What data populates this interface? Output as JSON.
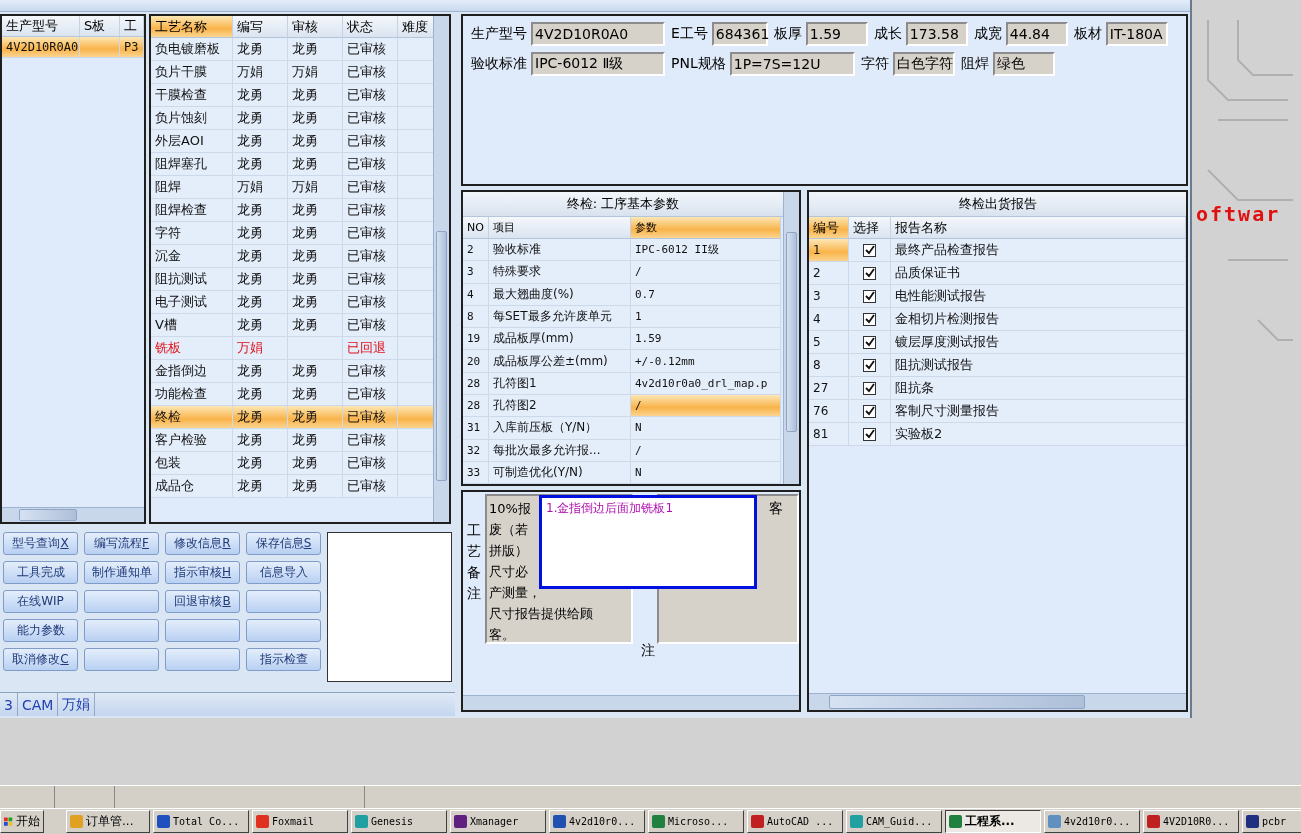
{
  "model_list": {
    "columns": [
      "生产型号",
      "S板",
      "工"
    ],
    "rows": [
      {
        "model": "4V2D10R0A0",
        "column_3": "P3",
        "selected": true
      }
    ]
  },
  "process_grid": {
    "columns": [
      {
        "label": "工艺名称",
        "highlighted": true
      },
      {
        "label": "编写",
        "highlighted": false
      },
      {
        "label": "审核",
        "highlighted": false
      },
      {
        "label": "状态",
        "highlighted": false
      },
      {
        "label": "难度",
        "highlighted": false
      }
    ],
    "rows": [
      {
        "name": "负电镀磨板",
        "writer": "龙勇",
        "reviewer": "龙勇",
        "status": "已审核",
        "returned": false,
        "selected": false
      },
      {
        "name": "负片干膜",
        "writer": "万娟",
        "reviewer": "万娟",
        "status": "已审核",
        "returned": false,
        "selected": false
      },
      {
        "name": "干膜检查",
        "writer": "龙勇",
        "reviewer": "龙勇",
        "status": "已审核",
        "returned": false,
        "selected": false
      },
      {
        "name": "负片蚀刻",
        "writer": "龙勇",
        "reviewer": "龙勇",
        "status": "已审核",
        "returned": false,
        "selected": false
      },
      {
        "name": "外层AOI",
        "writer": "龙勇",
        "reviewer": "龙勇",
        "status": "已审核",
        "returned": false,
        "selected": false
      },
      {
        "name": "阻焊塞孔",
        "writer": "龙勇",
        "reviewer": "龙勇",
        "status": "已审核",
        "returned": false,
        "selected": false
      },
      {
        "name": "阻焊",
        "writer": "万娟",
        "reviewer": "万娟",
        "status": "已审核",
        "returned": false,
        "selected": false
      },
      {
        "name": "阻焊检查",
        "writer": "龙勇",
        "reviewer": "龙勇",
        "status": "已审核",
        "returned": false,
        "selected": false
      },
      {
        "name": "字符",
        "writer": "龙勇",
        "reviewer": "龙勇",
        "status": "已审核",
        "returned": false,
        "selected": false
      },
      {
        "name": "沉金",
        "writer": "龙勇",
        "reviewer": "龙勇",
        "status": "已审核",
        "returned": false,
        "selected": false
      },
      {
        "name": "阻抗测试",
        "writer": "龙勇",
        "reviewer": "龙勇",
        "status": "已审核",
        "returned": false,
        "selected": false
      },
      {
        "name": "电子测试",
        "writer": "龙勇",
        "reviewer": "龙勇",
        "status": "已审核",
        "returned": false,
        "selected": false
      },
      {
        "name": "V槽",
        "writer": "龙勇",
        "reviewer": "龙勇",
        "status": "已审核",
        "returned": false,
        "selected": false
      },
      {
        "name": "铣板",
        "writer": "万娟",
        "status": "已回退",
        "returned": true,
        "selected": false
      },
      {
        "name": "金指倒边",
        "writer": "龙勇",
        "reviewer": "龙勇",
        "status": "已审核",
        "returned": false,
        "selected": false
      },
      {
        "name": "功能检查",
        "writer": "龙勇",
        "reviewer": "龙勇",
        "status": "已审核",
        "returned": false,
        "selected": false
      },
      {
        "name": "终检",
        "writer": "龙勇",
        "reviewer": "龙勇",
        "status": "已审核",
        "returned": false,
        "selected": true
      },
      {
        "name": "客户检验",
        "writer": "龙勇",
        "reviewer": "龙勇",
        "status": "已审核",
        "returned": false,
        "selected": false
      },
      {
        "name": "包装",
        "writer": "龙勇",
        "reviewer": "龙勇",
        "status": "已审核",
        "returned": false,
        "selected": false
      },
      {
        "name": "成品仓",
        "writer": "龙勇",
        "reviewer": "龙勇",
        "status": "已审核",
        "returned": false,
        "selected": false
      }
    ]
  },
  "buttons": [
    {
      "kind": "labeled",
      "label": "型号查询",
      "hotkey": "X"
    },
    {
      "kind": "labeled",
      "label": "编写流程",
      "hotkey": "F"
    },
    {
      "kind": "labeled",
      "label": "修改信息",
      "hotkey": "R"
    },
    {
      "kind": "labeled",
      "label": "保存信息",
      "hotkey": "S"
    },
    {
      "kind": "labeled",
      "label": "工具完成"
    },
    {
      "kind": "labeled",
      "label": "制作通知单"
    },
    {
      "kind": "labeled",
      "label": "指示审核",
      "hotkey": "H"
    },
    {
      "kind": "labeled",
      "label": "信息导入"
    },
    {
      "kind": "labeled",
      "label": "在线WIP"
    },
    {
      "kind": "blank"
    },
    {
      "kind": "labeled",
      "label": "回退审核",
      "hotkey": "B"
    },
    {
      "kind": "blank"
    },
    {
      "kind": "labeled",
      "label": "能力参数"
    },
    {
      "kind": "blank"
    },
    {
      "kind": "blank"
    },
    {
      "kind": "blank"
    },
    {
      "kind": "labeled",
      "label": "取消修改",
      "hotkey": "C"
    },
    {
      "kind": "blank"
    },
    {
      "kind": "blank"
    },
    {
      "kind": "labeled",
      "label": "指示检查"
    }
  ],
  "status_bar": [
    "3",
    "CAM",
    "万娟"
  ],
  "info": {
    "line_1": [
      {
        "label": "生产型号",
        "value": "4V2D10R0A0"
      },
      {
        "label": "E工号",
        "value": "684361"
      },
      {
        "label": "板厚",
        "value": "1.59"
      },
      {
        "label": "成长",
        "value": "173.58"
      },
      {
        "label": "成宽",
        "value": "44.84"
      },
      {
        "label": "板材",
        "value": "IT-180A"
      }
    ],
    "line_2": [
      {
        "label": "验收标准",
        "value": "IPC-6012 Ⅱ级"
      },
      {
        "label": "PNL规格",
        "value": "1P=7S=12U"
      },
      {
        "label": "字符",
        "value": "白色字符"
      },
      {
        "label": "阻焊",
        "value": "绿色"
      }
    ]
  },
  "params": {
    "title": "终检: 工序基本参数",
    "columns": [
      {
        "label": "NO",
        "highlighted": false
      },
      {
        "label": "项目",
        "highlighted": false
      },
      {
        "label": "参数",
        "highlighted": true
      }
    ],
    "rows": [
      {
        "no": "2",
        "item": "验收标准",
        "value": "IPC-6012 II级",
        "selected": false
      },
      {
        "no": "3",
        "item": "特殊要求",
        "value": "/",
        "selected": false
      },
      {
        "no": "4",
        "item": "最大翘曲度(%)",
        "value": "0.7",
        "selected": false
      },
      {
        "no": "8",
        "item": "每SET最多允许废单元",
        "value": "1",
        "selected": false
      },
      {
        "no": "19",
        "item": "成品板厚(mm)",
        "value": "1.59",
        "selected": false
      },
      {
        "no": "20",
        "item": "成品板厚公差±(mm)",
        "value": "+/-0.12mm",
        "selected": false
      },
      {
        "no": "28",
        "item": "孔符图1",
        "value": "4v2d10r0a0_drl_map.p",
        "selected": false
      },
      {
        "no": "28",
        "item": "孔符图2",
        "value": "/",
        "selected": true
      },
      {
        "no": "31",
        "item": "入库前压板（Y/N）",
        "value": "N",
        "selected": false
      },
      {
        "no": "32",
        "item": "每批次最多允许报...",
        "value": "/",
        "selected": false
      },
      {
        "no": "33",
        "item": "可制造优化(Y/N)",
        "value": "N",
        "selected": false
      }
    ]
  },
  "notes": {
    "label": "工艺备注",
    "memo_lines": [
      "10%报",
      "废（若",
      "拼版）",
      "尺寸必",
      "产测量，",
      "尺寸报告提供给顾",
      "客。"
    ],
    "popup": "1.金指倒边后面加铣板1",
    "label_2": "注",
    "memo_2": "客"
  },
  "report": {
    "title": "终检出货报告",
    "columns": [
      {
        "label": "编号",
        "highlighted": true
      },
      {
        "label": "选择",
        "highlighted": false
      },
      {
        "label": "报告名称",
        "highlighted": false
      }
    ],
    "rows": [
      {
        "no": "1",
        "checked": true,
        "name": "最终产品检查报告",
        "selected": true
      },
      {
        "no": "2",
        "checked": true,
        "name": "品质保证书",
        "selected": false
      },
      {
        "no": "3",
        "checked": true,
        "name": "电性能测试报告",
        "selected": false
      },
      {
        "no": "4",
        "checked": true,
        "name": "金相切片检测报告",
        "selected": false
      },
      {
        "no": "5",
        "checked": true,
        "name": "镀层厚度测试报告",
        "selected": false
      },
      {
        "no": "8",
        "checked": true,
        "name": "阻抗测试报告",
        "selected": false
      },
      {
        "no": "27",
        "checked": true,
        "name": "阻抗条",
        "selected": false
      },
      {
        "no": "76",
        "checked": true,
        "name": "客制尺寸测量报告",
        "selected": false
      },
      {
        "no": "81",
        "checked": true,
        "name": "实验板2",
        "selected": false
      }
    ]
  },
  "desktop": {
    "text": "oftwar"
  },
  "taskbar": {
    "start": "开始",
    "tasks": [
      {
        "label": "订单管...",
        "selected": false,
        "color": "#e0a020"
      },
      {
        "label": "Total Co...",
        "selected": false,
        "color": "#2050c0"
      },
      {
        "label": "Foxmail",
        "selected": false,
        "color": "#e03020"
      },
      {
        "label": "Genesis",
        "selected": false,
        "color": "#20a0a0"
      },
      {
        "label": "Xmanager",
        "selected": false,
        "color": "#602080"
      },
      {
        "label": "4v2d10r0...",
        "selected": false,
        "color": "#2050b0"
      },
      {
        "label": "Microso...",
        "selected": false,
        "color": "#208040"
      },
      {
        "label": "AutoCAD ...",
        "selected": false,
        "color": "#c02020"
      },
      {
        "label": "CAM_Guid...",
        "selected": false,
        "color": "#20a0a0"
      },
      {
        "label": "工程系...",
        "selected": true,
        "color": "#208040"
      },
      {
        "label": "4v2d10r0...",
        "selected": false,
        "color": "#6090c0"
      },
      {
        "label": "4V2D10R0...",
        "selected": false,
        "color": "#c02020"
      },
      {
        "label": "pcbr",
        "selected": false,
        "color": "#203080"
      }
    ]
  }
}
